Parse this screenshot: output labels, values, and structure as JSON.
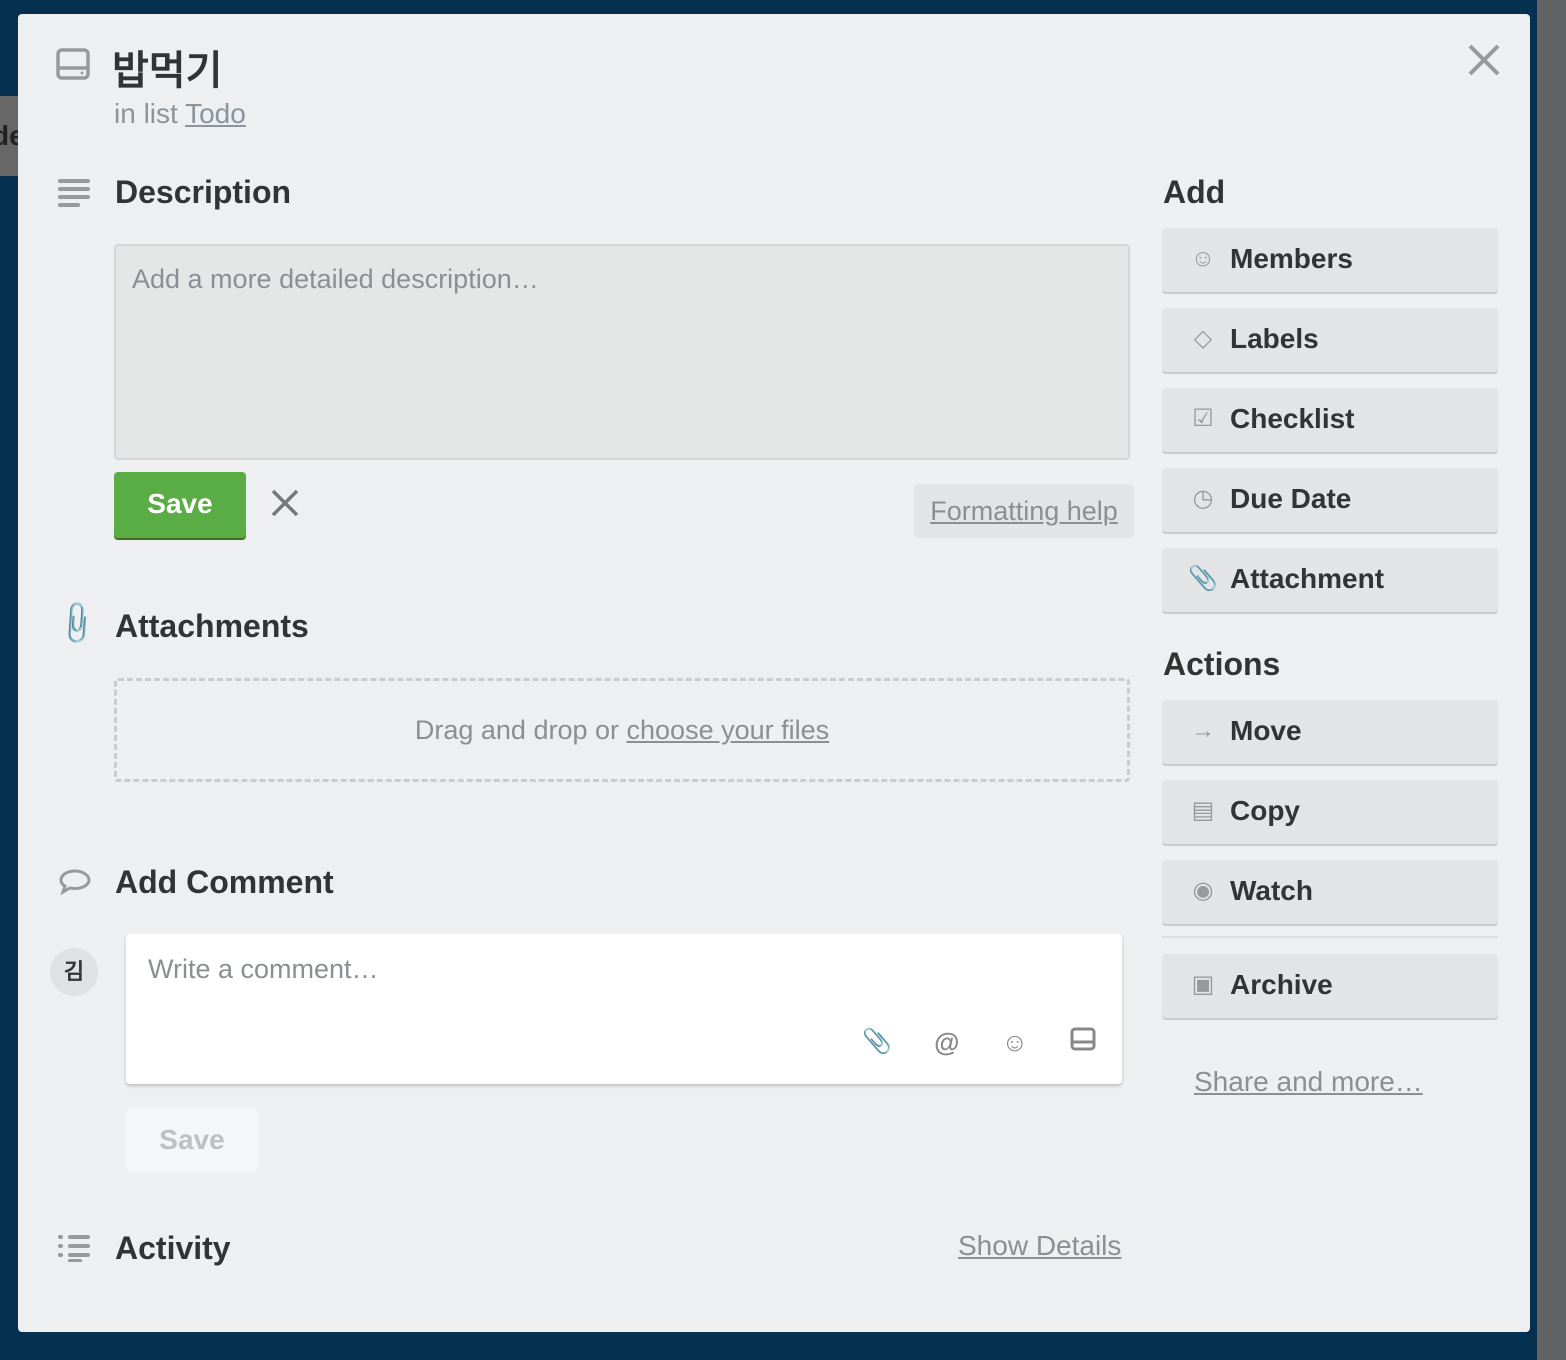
{
  "background": {
    "board_fragment": "de"
  },
  "card": {
    "title": "밥먹기",
    "in_list_prefix": "in list",
    "list_name": "Todo"
  },
  "description": {
    "heading": "Description",
    "placeholder": "Add a more detailed description…",
    "save_label": "Save",
    "formatting_help": "Formatting help"
  },
  "attachments": {
    "heading": "Attachments",
    "drop_text": "Drag and drop or",
    "choose_files": "choose your files"
  },
  "comment": {
    "heading": "Add Comment",
    "avatar_initial": "김",
    "placeholder": "Write a comment…",
    "save_label": "Save"
  },
  "activity": {
    "heading": "Activity",
    "show_details": "Show Details"
  },
  "sidebar": {
    "add_heading": "Add",
    "add_items": [
      {
        "label": "Members",
        "icon": "person-icon"
      },
      {
        "label": "Labels",
        "icon": "tag-icon"
      },
      {
        "label": "Checklist",
        "icon": "checkbox-icon"
      },
      {
        "label": "Due Date",
        "icon": "clock-icon"
      },
      {
        "label": "Attachment",
        "icon": "paperclip-icon"
      }
    ],
    "actions_heading": "Actions",
    "action_items": [
      {
        "label": "Move",
        "icon": "arrow-right-icon"
      },
      {
        "label": "Copy",
        "icon": "card-icon"
      },
      {
        "label": "Watch",
        "icon": "eye-icon"
      },
      {
        "label": "Archive",
        "icon": "archive-icon"
      }
    ],
    "share": "Share and more…"
  }
}
